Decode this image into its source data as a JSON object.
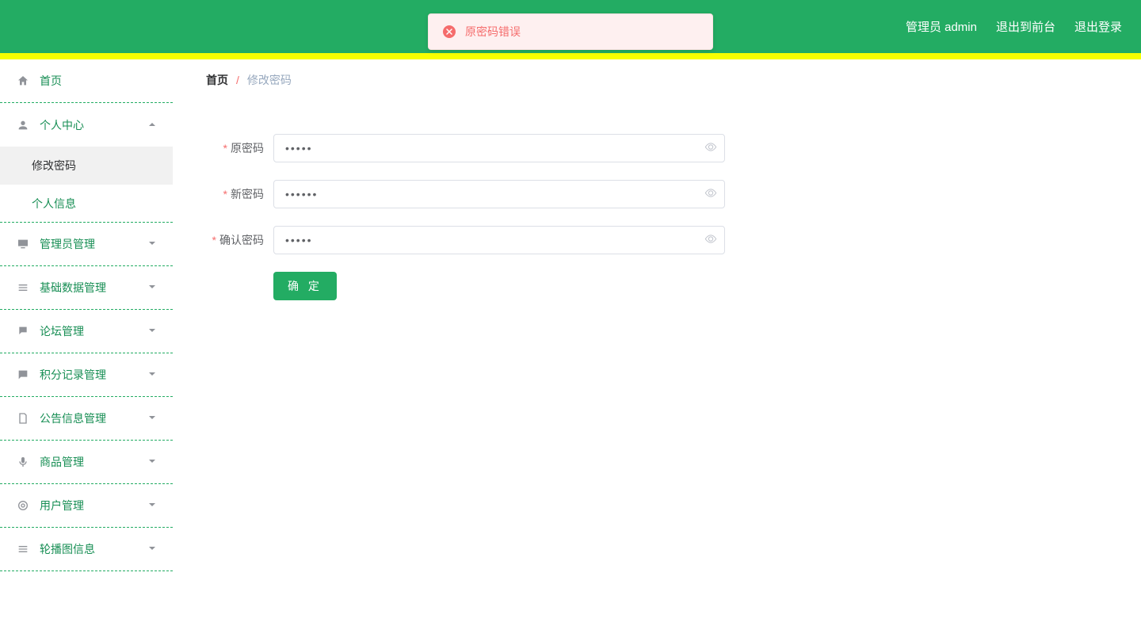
{
  "header": {
    "user_label": "管理员 admin",
    "logout_front": "退出到前台",
    "logout": "退出登录"
  },
  "alert": {
    "text": "原密码错误"
  },
  "sidebar": {
    "home": "首页",
    "personal": "个人中心",
    "change_pw": "修改密码",
    "profile": "个人信息",
    "admin_mgmt": "管理员管理",
    "base_data": "基础数据管理",
    "forum": "论坛管理",
    "points": "积分记录管理",
    "notice": "公告信息管理",
    "goods": "商品管理",
    "user_mgmt": "用户管理",
    "carousel": "轮播图信息"
  },
  "breadcrumb": {
    "home": "首页",
    "sep": "/",
    "current": "修改密码"
  },
  "form": {
    "old_pw_label": "原密码",
    "new_pw_label": "新密码",
    "confirm_pw_label": "确认密码",
    "old_pw_value": "•••••",
    "new_pw_value": "••••••",
    "confirm_pw_value": "•••••",
    "submit": "确 定"
  }
}
